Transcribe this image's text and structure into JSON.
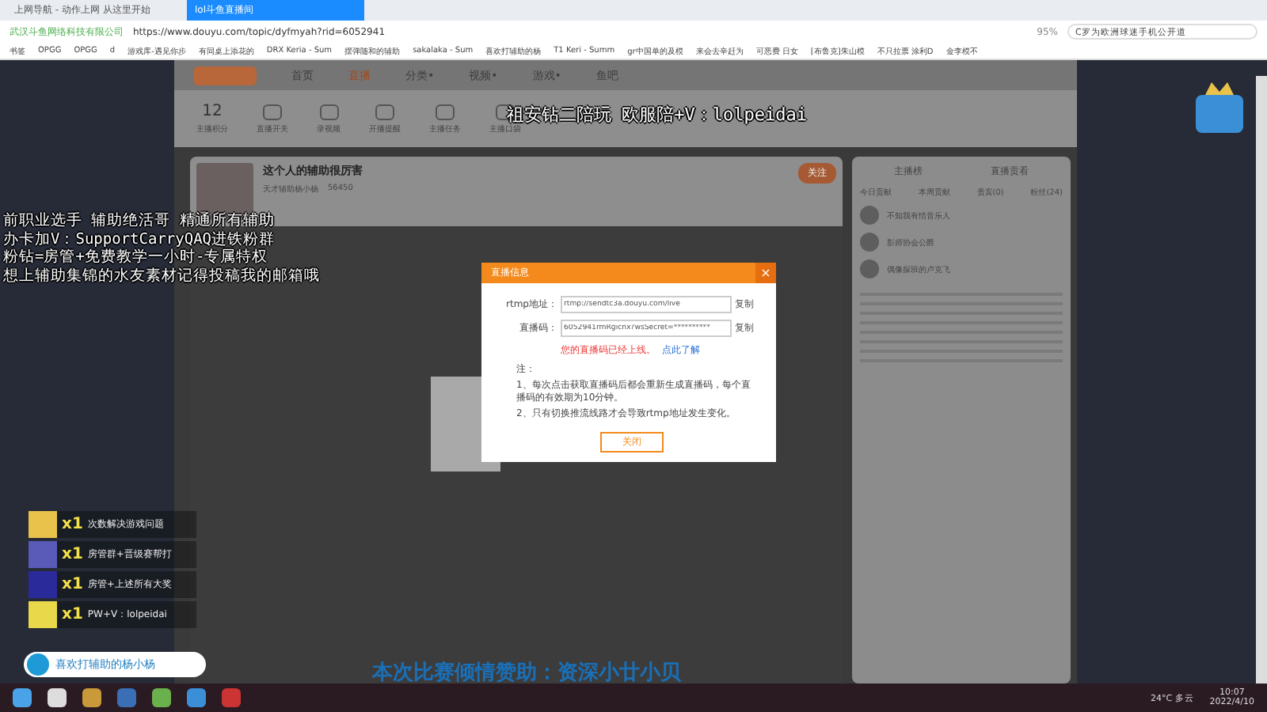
{
  "browser": {
    "tabs": [
      {
        "label": "上网导航 - 动作上网 从这里开始",
        "selected": false
      },
      {
        "label": "lol斗鱼直播间",
        "selected": true
      }
    ],
    "site_label": "武汉斗鱼网络科技有限公司",
    "url": "https://www.douyu.com/topic/dyfmyah?rid=6052941",
    "zoom": "95%",
    "search": "C罗为欧洲球迷手机公开道",
    "bookmarks": [
      "书签",
      "OPGG",
      "OPGG",
      "d",
      "游戏库-遇见你步",
      "有同桌上添花的",
      "DRX Keria - Sum",
      "摆弹随和的辅助",
      "sakalaka - Sum",
      "喜欢打辅助的杨",
      "T1 Keri - Summ",
      "gr中国单的及模",
      "来会去辛赶为",
      "可恶费 日女",
      "[布鲁克]朱山模",
      "不只拉票 涂利D",
      "金李模不"
    ]
  },
  "site": {
    "nav": [
      {
        "label": "首页",
        "selected": false
      },
      {
        "label": "直播",
        "selected": true
      },
      {
        "label": "分类•",
        "selected": false
      },
      {
        "label": "视频•",
        "selected": false
      },
      {
        "label": "游戏•",
        "selected": false
      },
      {
        "label": "鱼吧",
        "selected": false
      }
    ],
    "tools": [
      {
        "value": "12",
        "label": "主播积分"
      },
      {
        "label": "直播开关"
      },
      {
        "label": "录视频"
      },
      {
        "label": "开播提醒"
      },
      {
        "label": "主播任务"
      },
      {
        "label": "主播口袋"
      }
    ],
    "streamer": {
      "title": "这个人的辅助很厉害",
      "name": "天才辅助杨小杨",
      "heat": "56450",
      "follow": "关注"
    },
    "sidebar": {
      "tabs": [
        "主播榜",
        "直播贡看"
      ],
      "rank_tabs": [
        "今日贡献",
        "本周贡献",
        "贵宾(0)",
        "粉丝(24)"
      ],
      "rows": [
        "不知我有情音乐人",
        "影师协会公爵",
        "偶像探班的卢克飞"
      ]
    }
  },
  "stream_overlay": {
    "headline": "祖安钻二陪玩 欧服陪+V：lolpeidai",
    "notes": [
      "前职业选手 辅助绝活哥 精通所有辅助",
      "办卡加V：SupportCarryQAQ进铁粉群",
      "粉钻=房管+免费教学一小时-专属特权",
      "想上辅助集锦的水友素材记得投稿我的邮箱哦"
    ],
    "prizes": [
      {
        "count": "x1",
        "text": "次数解决游戏问题"
      },
      {
        "count": "x1",
        "text": "房管群+晋级赛帮打"
      },
      {
        "count": "x1",
        "text": "房管+上述所有大奖"
      },
      {
        "count": "x1",
        "text": "PW+V：lolpeidai"
      }
    ],
    "name_badge": "喜欢打辅助的杨小杨",
    "banner": "本次比赛倾情赞助：资深小廿小贝"
  },
  "dialog": {
    "title": "直播信息",
    "close": "×",
    "fields": [
      {
        "label": "rtmp地址：",
        "value": "rtmp://sendtc3a.douyu.com/live",
        "copy": "复制"
      },
      {
        "label": "直播码：",
        "value": "6052941rmRgicnx?wsSecret=**********",
        "copy": "复制"
      }
    ],
    "warning": "您的直播码已经上线。",
    "link": "点此了解",
    "note_title": "注：",
    "notes": [
      "1、每次点击获取直播码后都会重新生成直播码，每个直播码的有效期为10分钟。",
      "2、只有切换推流线路才会导致rtmp地址发生变化。"
    ],
    "button": "关闭"
  },
  "taskbar": {
    "weather": "24°C 多云",
    "time": "10:07",
    "date": "2022/4/10"
  }
}
